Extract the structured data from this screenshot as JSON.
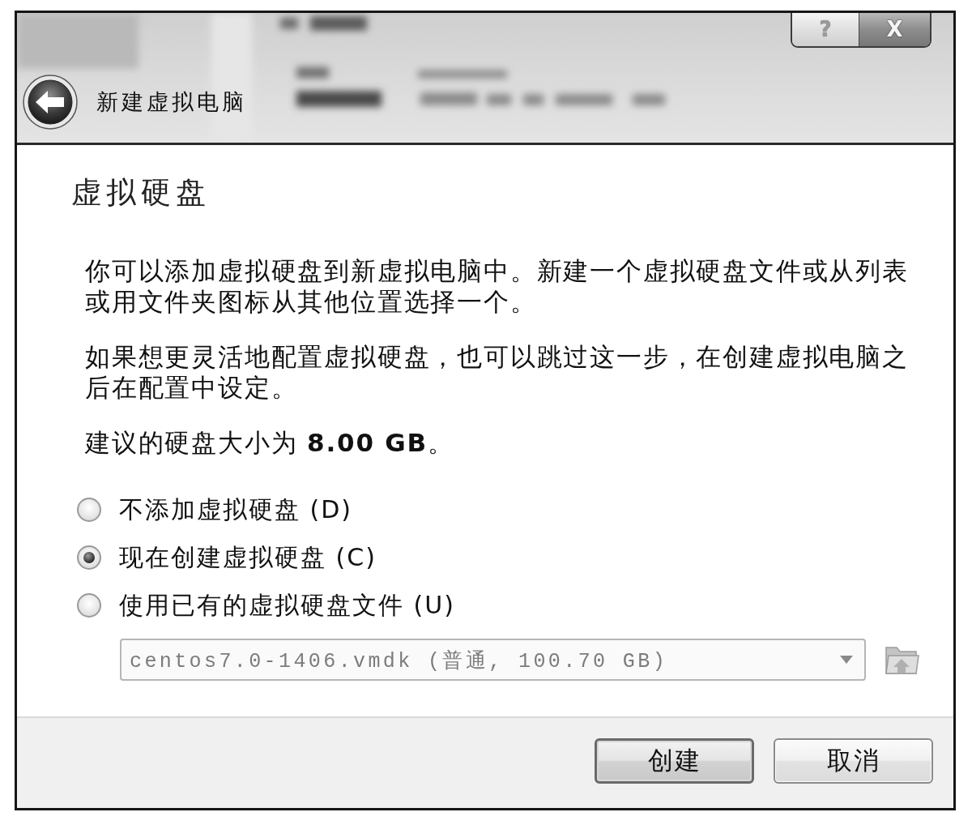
{
  "window": {
    "title": "新建虚拟电脑",
    "help_button": "?",
    "close_button": "X"
  },
  "page": {
    "heading": "虚拟硬盘",
    "paragraphs": [
      "你可以添加虚拟硬盘到新虚拟电脑中。新建一个虚拟硬盘文件或从列表或用文件夹图标从其他位置选择一个。",
      "如果想更灵活地配置虚拟硬盘，也可以跳过这一步，在创建虚拟电脑之后在配置中设定。",
      "建议的硬盘大小为 **8.00 GB**。"
    ]
  },
  "options": [
    {
      "label": "不添加虚拟硬盘 (D)",
      "selected": false
    },
    {
      "label": "现在创建虚拟硬盘 (C)",
      "selected": true
    },
    {
      "label": "使用已有的虚拟硬盘文件 (U)",
      "selected": false
    }
  ],
  "disk_select": {
    "value": "centos7.0-1406.vmdk (普通, 100.70 GB)",
    "disabled": true
  },
  "buttons": [
    {
      "label": "创建",
      "default": true
    },
    {
      "label": "取消",
      "default": false
    }
  ]
}
